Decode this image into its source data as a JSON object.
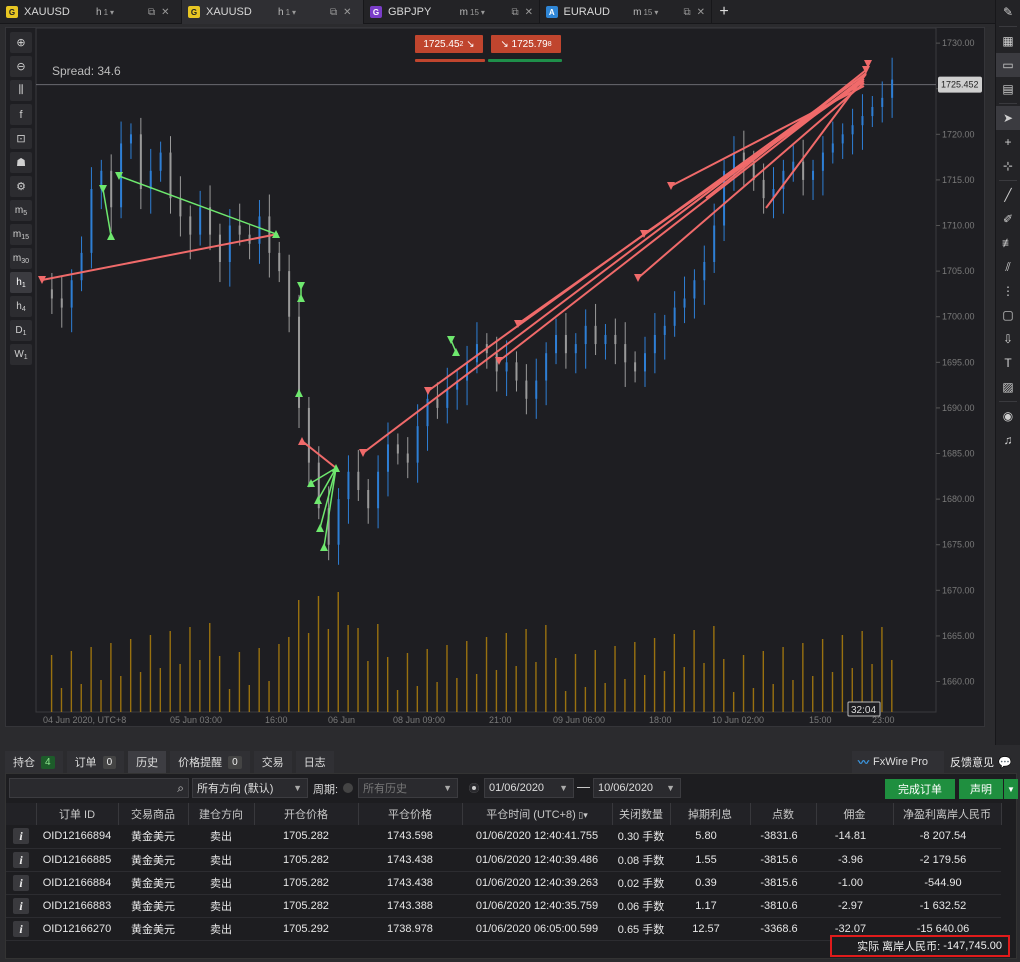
{
  "chart_tabs": [
    {
      "symbol": "XAUUSD",
      "icon_letter": "G",
      "icon_color": "#e8c623",
      "tf": "h",
      "tf_sub": "1",
      "active": false
    },
    {
      "symbol": "XAUUSD",
      "icon_letter": "G",
      "icon_color": "#e8c623",
      "tf": "h",
      "tf_sub": "1",
      "active": true
    },
    {
      "symbol": "GBPJPY",
      "icon_letter": "G",
      "icon_color": "#7a3dc8",
      "tf": "m",
      "tf_sub": "15",
      "active": false
    },
    {
      "symbol": "EURAUD",
      "icon_letter": "A",
      "icon_color": "#2f86d6",
      "tf": "m",
      "tf_sub": "15",
      "active": false
    }
  ],
  "chart": {
    "spread_label": "Spread:",
    "spread_value": "34.6",
    "sell_price": "1725.45",
    "sell_price_sup": "2",
    "buy_price": "1725.79",
    "buy_price_sup": "8",
    "current_price_label": "1725.452",
    "countdown": "32:04",
    "colors": {
      "up": "#2e7fd6",
      "down": "#9a9a9a",
      "volume": "#b8860b",
      "buy_line": "#6ee86e",
      "sell_line": "#f06a6a",
      "sell_box": "#c0452e"
    }
  },
  "chart_data": {
    "type": "candlestick",
    "y_ticks": [
      "1730.00",
      "1725.00",
      "1720.00",
      "1715.00",
      "1710.00",
      "1705.00",
      "1700.00",
      "1695.00",
      "1690.00",
      "1685.00",
      "1680.00",
      "1675.00",
      "1670.00",
      "1665.00",
      "1660.00"
    ],
    "x_ticks": [
      "04 Jun 2020, UTC+8",
      "05 Jun 03:00",
      "16:00",
      "06 Jun",
      "08 Jun 09:00",
      "21:00",
      "09 Jun 06:00",
      "18:00",
      "10 Jun 02:00",
      "15:00",
      "23:00"
    ],
    "ylim": [
      1656,
      1731
    ]
  },
  "left_tools": [
    {
      "name": "zoom-in-icon",
      "glyph": "⊕"
    },
    {
      "name": "zoom-out-icon",
      "glyph": "⊖"
    },
    {
      "name": "candles-icon",
      "glyph": "⫼"
    },
    {
      "name": "facebook-icon",
      "glyph": "f"
    },
    {
      "name": "bot-icon",
      "glyph": "⊡"
    },
    {
      "name": "incognito-icon",
      "glyph": "☗"
    },
    {
      "name": "settings-icon",
      "glyph": "⚙"
    }
  ],
  "timeframes": [
    {
      "t": "m",
      "s": "5"
    },
    {
      "t": "m",
      "s": "15"
    },
    {
      "t": "m",
      "s": "30"
    },
    {
      "t": "h",
      "s": "1"
    },
    {
      "t": "h",
      "s": "4"
    },
    {
      "t": "D",
      "s": "1"
    },
    {
      "t": "W",
      "s": "1"
    }
  ],
  "bottom_tabs": [
    {
      "label": "持仓",
      "badge": "4",
      "green": true
    },
    {
      "label": "订单",
      "badge": "0",
      "green": false
    },
    {
      "label": "历史",
      "badge": "",
      "green": false,
      "active": true
    },
    {
      "label": "价格提醒",
      "badge": "0",
      "green": false
    },
    {
      "label": "交易",
      "badge": "",
      "green": false
    },
    {
      "label": "日志",
      "badge": "",
      "green": false
    }
  ],
  "fxwire_label": "FxWire Pro",
  "feedback_label": "反馈意见",
  "filters": {
    "direction": "所有方向 (默认)",
    "period_label": "周期:",
    "period_value": "所有历史",
    "date_from": "01/06/2020",
    "date_to": "10/06/2020",
    "complete_orders": "完成订单",
    "statement": "声明"
  },
  "table": {
    "headers": [
      "",
      "订单 ID",
      "交易商品",
      "建仓方向",
      "开仓价格",
      "平仓价格",
      "平仓时间 (UTC+8)",
      "关闭数量",
      "掉期利息",
      "点数",
      "佣金",
      "净盈利离岸人民币"
    ],
    "rows": [
      {
        "id": "OID12166894",
        "symbol": "黄金美元",
        "dir": "卖出",
        "open": "1705.282",
        "close": "1743.598",
        "time": "01/06/2020 12:40:41.755",
        "qty": "0.30 手数",
        "swap": "5.80",
        "pips": "-3831.6",
        "comm": "-14.81",
        "net": "-8 207.54"
      },
      {
        "id": "OID12166885",
        "symbol": "黄金美元",
        "dir": "卖出",
        "open": "1705.282",
        "close": "1743.438",
        "time": "01/06/2020 12:40:39.486",
        "qty": "0.08 手数",
        "swap": "1.55",
        "pips": "-3815.6",
        "comm": "-3.96",
        "net": "-2 179.56"
      },
      {
        "id": "OID12166884",
        "symbol": "黄金美元",
        "dir": "卖出",
        "open": "1705.282",
        "close": "1743.438",
        "time": "01/06/2020 12:40:39.263",
        "qty": "0.02 手数",
        "swap": "0.39",
        "pips": "-3815.6",
        "comm": "-1.00",
        "net": "-544.90"
      },
      {
        "id": "OID12166883",
        "symbol": "黄金美元",
        "dir": "卖出",
        "open": "1705.282",
        "close": "1743.388",
        "time": "01/06/2020 12:40:35.759",
        "qty": "0.06 手数",
        "swap": "1.17",
        "pips": "-3810.6",
        "comm": "-2.97",
        "net": "-1 632.52"
      },
      {
        "id": "OID12166270",
        "symbol": "黄金美元",
        "dir": "卖出",
        "open": "1705.292",
        "close": "1738.978",
        "time": "01/06/2020 06:05:00.599",
        "qty": "0.65 手数",
        "swap": "12.57",
        "pips": "-3368.6",
        "comm": "-32.07",
        "net": "-15 640.06"
      }
    ]
  },
  "total_label": "实际 离岸人民币:",
  "total_value": "-147,745.00"
}
